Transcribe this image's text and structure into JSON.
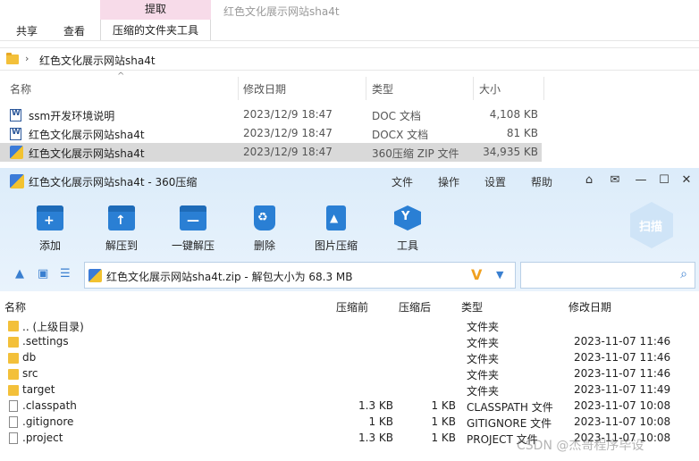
{
  "explorer": {
    "ribbon": {
      "context_header": "提取",
      "context_title": "红色文化展示网站sha4t",
      "tabs": [
        "共享",
        "查看"
      ],
      "active_tab": "压缩的文件夹工具"
    },
    "address": {
      "path": "红色文化展示网站sha4t"
    },
    "columns": {
      "name": "名称",
      "date": "修改日期",
      "type": "类型",
      "size": "大小"
    },
    "files": [
      {
        "name": "ssm开发环境说明",
        "date": "2023/12/9 18:47",
        "type": "DOC 文档",
        "size": "4,108 KB",
        "icon": "word-doc-icon"
      },
      {
        "name": "红色文化展示网站sha4t",
        "date": "2023/12/9 18:47",
        "type": "DOCX 文档",
        "size": "81 KB",
        "icon": "word-doc-icon"
      },
      {
        "name": "红色文化展示网站sha4t",
        "date": "2023/12/9 18:47",
        "type": "360压缩 ZIP 文件",
        "size": "34,935 KB",
        "icon": "zip-icon",
        "selected": true
      }
    ]
  },
  "archive_window": {
    "title": "红色文化展示网站sha4t - 360压缩",
    "menu": [
      "文件",
      "操作",
      "设置",
      "帮助"
    ],
    "toolbar": [
      {
        "label": "添加",
        "icon": "add-icon",
        "glyph": "+"
      },
      {
        "label": "解压到",
        "icon": "extract-to-icon",
        "glyph": "↑"
      },
      {
        "label": "一键解压",
        "icon": "one-click-extract-icon",
        "glyph": "—"
      },
      {
        "label": "删除",
        "icon": "recycle-icon",
        "glyph": "♻"
      },
      {
        "label": "图片压缩",
        "icon": "image-compress-icon",
        "glyph": "▲"
      },
      {
        "label": "工具",
        "icon": "tools-icon",
        "glyph": "Y"
      }
    ],
    "scan_label": "扫描",
    "path_text": "红色文化展示网站sha4t.zip - 解包大小为 68.3 MB",
    "path_badge": "V",
    "columns": {
      "name": "名称",
      "before": "压缩前",
      "after": "压缩后",
      "type": "类型",
      "date": "修改日期"
    },
    "rows": [
      {
        "name": ".. (上级目录)",
        "before": "",
        "after": "",
        "type": "文件夹",
        "date": "",
        "kind": "folder"
      },
      {
        "name": ".settings",
        "before": "",
        "after": "",
        "type": "文件夹",
        "date": "2023-11-07 11:46",
        "kind": "folder"
      },
      {
        "name": "db",
        "before": "",
        "after": "",
        "type": "文件夹",
        "date": "2023-11-07 11:46",
        "kind": "folder"
      },
      {
        "name": "src",
        "before": "",
        "after": "",
        "type": "文件夹",
        "date": "2023-11-07 11:46",
        "kind": "folder"
      },
      {
        "name": "target",
        "before": "",
        "after": "",
        "type": "文件夹",
        "date": "2023-11-07 11:49",
        "kind": "folder"
      },
      {
        "name": ".classpath",
        "before": "1.3 KB",
        "after": "1 KB",
        "type": "CLASSPATH 文件",
        "date": "2023-11-07 10:08",
        "kind": "file"
      },
      {
        "name": ".gitignore",
        "before": "1 KB",
        "after": "1 KB",
        "type": "GITIGNORE 文件",
        "date": "2023-11-07 10:08",
        "kind": "file"
      },
      {
        "name": ".project",
        "before": "1.3 KB",
        "after": "1 KB",
        "type": "PROJECT 文件",
        "date": "2023-11-07 10:08",
        "kind": "file"
      }
    ]
  },
  "watermark": "CSDN @杰哥程序毕设"
}
